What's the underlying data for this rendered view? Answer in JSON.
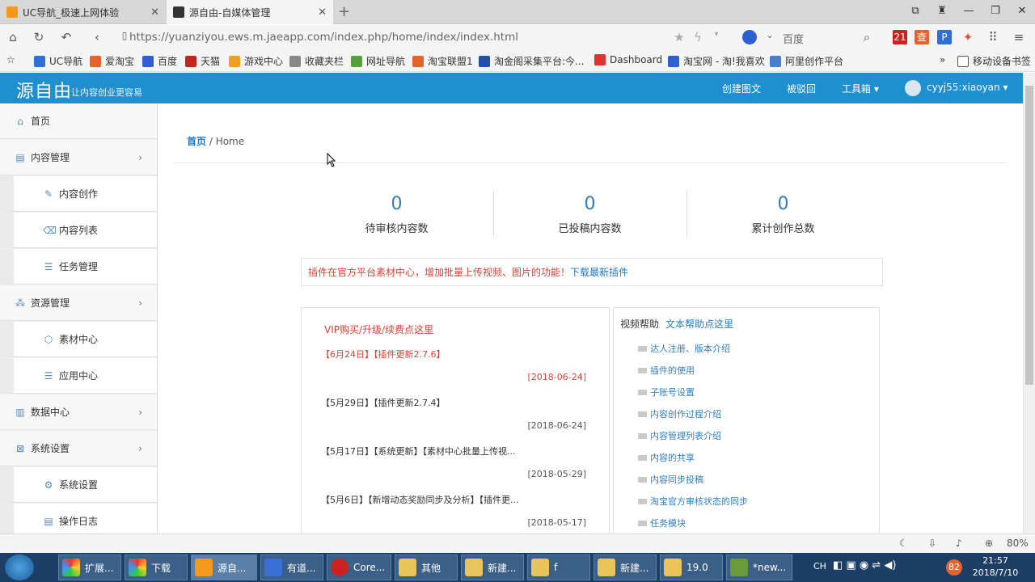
{
  "browser": {
    "tabs": [
      {
        "title": "UC导航_极速上网体验"
      },
      {
        "title": "源自由-自媒体管理"
      }
    ],
    "url": "https://yuanziyou.ews.m.jaeapp.com/index.php/home/index/index.html",
    "search_placeholder": "百度",
    "bookmarks": [
      "UC导航",
      "爱淘宝",
      "百度",
      "天猫",
      "游戏中心",
      "收藏夹栏",
      "网址导航",
      "淘宝联盟1",
      "淘金阁采集平台:今...",
      "Dashboard",
      "淘宝网 - 淘!我喜欢",
      "阿里创作平台"
    ],
    "bookmarks_more": "»",
    "mobile_bookmarks": "移动设备书签"
  },
  "app": {
    "logo": "源自由",
    "slogan": "让内容创业更容易",
    "nav": {
      "create": "创建图文",
      "recycle": "被驳回",
      "tools": "工具箱 ▾",
      "user": "cyyj55:xiaoyan ▾"
    }
  },
  "sidebar": {
    "items": [
      {
        "label": "首页",
        "type": "top"
      },
      {
        "label": "内容管理",
        "type": "top",
        "chev": "›"
      },
      {
        "label": "内容创作",
        "type": "sub"
      },
      {
        "label": "内容列表",
        "type": "sub"
      },
      {
        "label": "任务管理",
        "type": "sub"
      },
      {
        "label": "资源管理",
        "type": "top",
        "chev": "›"
      },
      {
        "label": "素材中心",
        "type": "sub"
      },
      {
        "label": "应用中心",
        "type": "sub"
      },
      {
        "label": "数据中心",
        "type": "top",
        "chev": "›"
      },
      {
        "label": "系统设置",
        "type": "top",
        "chev": "›"
      },
      {
        "label": "系统设置",
        "type": "sub"
      },
      {
        "label": "操作日志",
        "type": "sub"
      }
    ]
  },
  "main": {
    "breadcrumb_home": "首页",
    "breadcrumb_rest": " / Home",
    "stats": [
      {
        "value": "0",
        "label": "待审核内容数"
      },
      {
        "value": "0",
        "label": "已投稿内容数"
      },
      {
        "value": "0",
        "label": "累计创作总数"
      }
    ],
    "notice_text": "插件在官方平台素材中心，增加批量上传视频、图片的功能！",
    "notice_link": "下载最新插件",
    "vip": "VIP购买/升级/续费点这里",
    "news": [
      {
        "title": "【6月24日】【插件更新2.7.6】",
        "date": "[2018-06-24]",
        "highlight": true
      },
      {
        "title": "【5月29日】【插件更新2.7.4】",
        "date": "[2018-06-24]",
        "highlight": false
      },
      {
        "title": "【5月17日】【系统更新】【素材中心批量上传视...",
        "date": "[2018-05-29]",
        "highlight": false
      },
      {
        "title": "【5月6日】【新增动态奖励同步及分析】【插件更...",
        "date": "[2018-05-17]",
        "highlight": false
      }
    ],
    "help_title": "视频帮助",
    "help_text_link": "文本帮助点这里",
    "help_links": [
      "达人注册、版本介绍",
      "插件的使用",
      "子账号设置",
      "内容创作过程介绍",
      "内容管理列表介绍",
      "内容的共享",
      "内容同步投稿",
      "淘宝官方审核状态的同步",
      "任务模块"
    ]
  },
  "statusbar": {
    "zoom": "80%"
  },
  "taskbar": {
    "items": [
      "扩展...",
      "下载",
      "源自...",
      "有道...",
      "Core...",
      "其他",
      "新建...",
      "f",
      "新建...",
      "19.0",
      "*new..."
    ],
    "lang": "CH",
    "badge": "82",
    "time": "21:57",
    "date": "2018/7/10"
  }
}
